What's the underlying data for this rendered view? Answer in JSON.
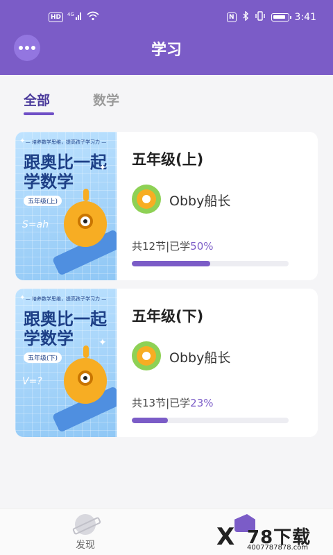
{
  "status_bar": {
    "hd_badge": "HD",
    "network": "4G",
    "time": "3:41",
    "nfc_label": "N"
  },
  "header": {
    "title": "学习"
  },
  "tabs": [
    {
      "label": "全部",
      "active": true
    },
    {
      "label": "数学",
      "active": false
    }
  ],
  "courses": [
    {
      "cover_small_text": "— 培养数学思维，提高孩子学习力 —",
      "cover_title_line1": "跟奥比一起",
      "cover_title_line2": "学数学",
      "cover_grade": "五年级(上)",
      "cover_formula": "S=ah",
      "title": "五年级(上)",
      "teacher": "Obby船长",
      "lessons_prefix": "共12节|已学",
      "progress_text": "50%",
      "progress": 0.5
    },
    {
      "cover_small_text": "— 培养数学思维，提高孩子学习力 —",
      "cover_title_line1": "跟奥比一起",
      "cover_title_line2": "学数学",
      "cover_grade": "五年级(下)",
      "cover_formula": "V=?",
      "title": "五年级(下)",
      "teacher": "Obby船长",
      "lessons_prefix": "共13节|已学",
      "progress_text": "23%",
      "progress": 0.23
    }
  ],
  "tabbar": {
    "discover_label": "发现"
  },
  "watermark": {
    "brand": "78下载",
    "url": "4007787878.com"
  },
  "colors": {
    "accent": "#7b5cc7",
    "tab_active": "#4c3c9c"
  }
}
